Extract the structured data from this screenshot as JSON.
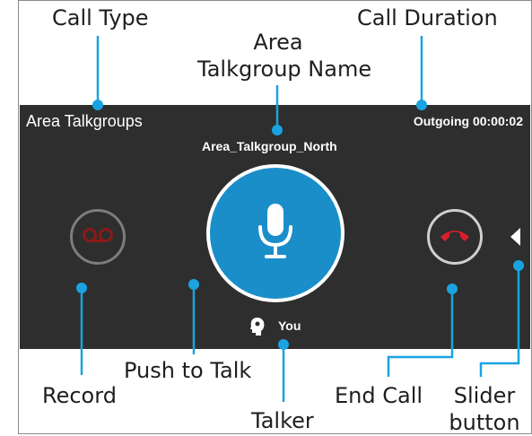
{
  "callouts": {
    "call_type": "Call Type",
    "call_duration": "Call Duration",
    "area_name_line1": "Area",
    "area_name_line2": "Talkgroup Name",
    "record": "Record",
    "push_to_talk": "Push to Talk",
    "talker": "Talker",
    "end_call": "End Call",
    "slider_line1": "Slider",
    "slider_line2": "button"
  },
  "call_panel": {
    "call_type_label": "Area Talkgroups",
    "talkgroup_name": "Area_Talkgroup_North",
    "status": "Outgoing 00:00:02",
    "talker": "You"
  },
  "icons": {
    "record": "voicemail-icon",
    "push_to_talk": "microphone-icon",
    "end_call": "phone-hangup-icon",
    "slider": "triangle-left-icon",
    "talker": "speaking-head-icon"
  },
  "colors": {
    "panel_bg": "#2e2e2e",
    "ptt_blue": "#1a8ec9",
    "end_call_red": "#d9202a",
    "record_red": "#8a1a1a",
    "callout_blue": "#1aa3e0"
  }
}
